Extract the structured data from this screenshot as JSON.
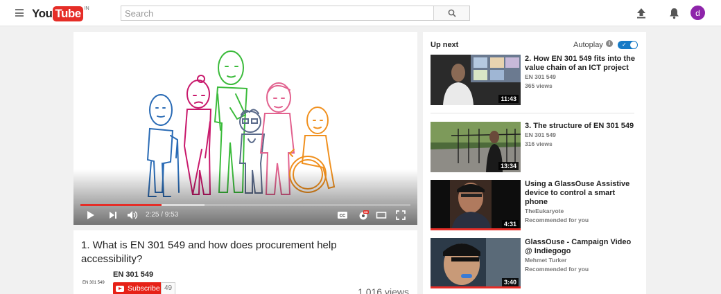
{
  "header": {
    "logo_you": "You",
    "logo_tube": "Tube",
    "logo_region": "IN",
    "search_placeholder": "Search",
    "avatar_letter": "d"
  },
  "player": {
    "current_time": "2:25",
    "duration": "9:53",
    "time_display": "2:25 / 9:53",
    "progress_fraction": 0.245,
    "buffered_fraction": 0.375,
    "icons": [
      "play-icon",
      "next-icon",
      "volume-icon",
      "captions-icon",
      "settings-hd-icon",
      "theater-mode-icon",
      "fullscreen-icon"
    ]
  },
  "video": {
    "title": "1. What is EN 301 549 and how does procurement help accessibility?",
    "channel_logo_text": "EN 301 549",
    "channel": "EN 301 549",
    "subscribe_label": "Subscribe",
    "subscriber_count": "49",
    "views": "1,016 views"
  },
  "sidebar": {
    "up_next_label": "Up next",
    "autoplay_label": "Autoplay",
    "autoplay_on": true,
    "items": [
      {
        "title": "2. How EN 301 549 fits into the value chain of an ICT project",
        "channel": "EN 301 549",
        "meta": "365 views",
        "duration": "11:43",
        "watched_fraction": 0
      },
      {
        "title": "3. The structure of EN 301 549",
        "channel": "EN 301 549",
        "meta": "316 views",
        "duration": "13:34",
        "watched_fraction": 0
      },
      {
        "title": "Using a GlassOuse Assistive device to control a smart phone",
        "channel": "TheEukaryote",
        "meta": "Recommended for you",
        "duration": "4:31",
        "watched_fraction": 1.0
      },
      {
        "title": "GlassOuse - Campaign Video @ Indiegogo",
        "channel": "Mehmet Turker",
        "meta": "Recommended for you",
        "duration": "3:40",
        "watched_fraction": 1.0
      }
    ]
  },
  "colors": {
    "brand_red": "#e52d27",
    "autoplay_blue": "#167ac6",
    "avatar_purple": "#8e24aa"
  }
}
